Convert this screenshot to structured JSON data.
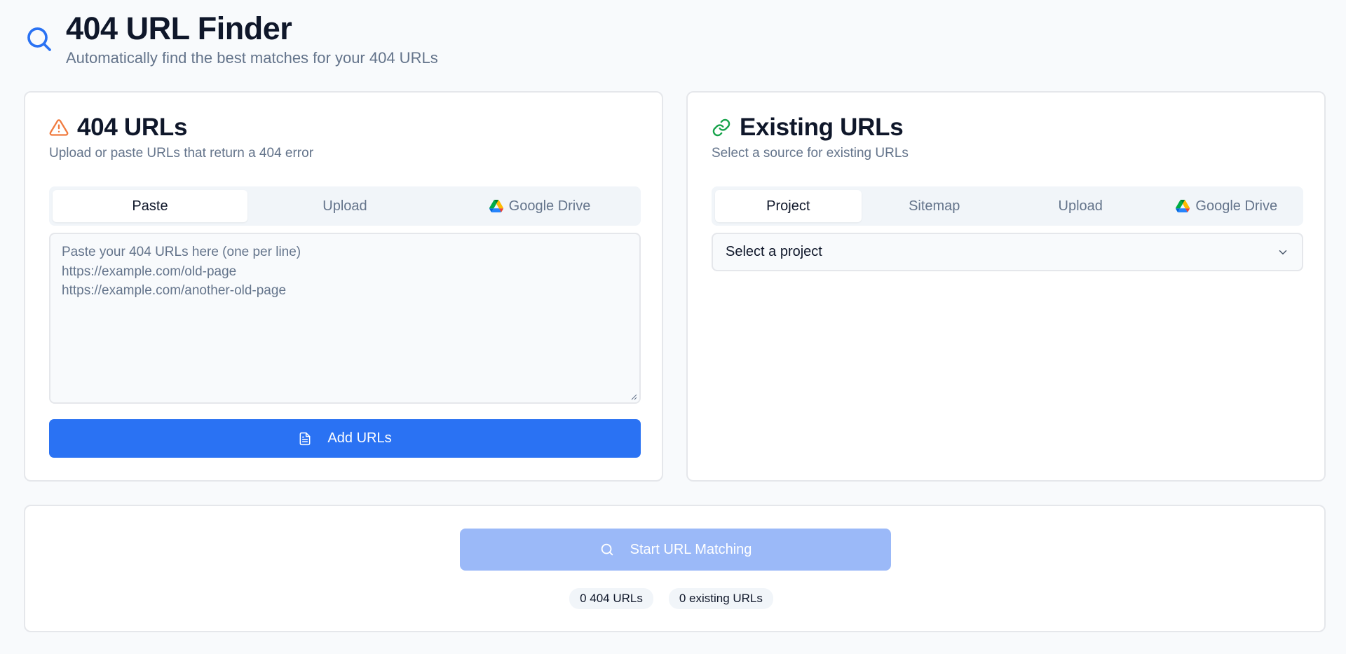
{
  "header": {
    "title": "404 URL Finder",
    "subtitle": "Automatically find the best matches for your 404 URLs",
    "icon": "search-icon"
  },
  "left_panel": {
    "title": "404 URLs",
    "icon": "warning-triangle-icon",
    "subtitle": "Upload or paste URLs that return a 404 error",
    "tabs": [
      {
        "label": "Paste",
        "active": true
      },
      {
        "label": "Upload",
        "active": false
      },
      {
        "label": "Google Drive",
        "active": false,
        "icon": "google-drive-icon"
      }
    ],
    "textarea_placeholder": "Paste your 404 URLs here (one per line)\nhttps://example.com/old-page\nhttps://example.com/another-old-page",
    "textarea_value": "",
    "add_button_label": "Add URLs",
    "add_button_icon": "file-text-icon"
  },
  "right_panel": {
    "title": "Existing URLs",
    "icon": "link-icon",
    "subtitle": "Select a source for existing URLs",
    "tabs": [
      {
        "label": "Project",
        "active": true
      },
      {
        "label": "Sitemap",
        "active": false
      },
      {
        "label": "Upload",
        "active": false
      },
      {
        "label": "Google Drive",
        "active": false,
        "icon": "google-drive-icon"
      }
    ],
    "select_placeholder": "Select a project"
  },
  "bottom_panel": {
    "start_button_label": "Start URL Matching",
    "start_button_disabled": true,
    "badge_404": "0 404 URLs",
    "badge_existing": "0 existing URLs"
  },
  "colors": {
    "primary": "#2a72f3",
    "primary_disabled": "#9bb9f8",
    "warning": "#f07b3f",
    "link": "#16a34a",
    "muted_text": "#64748b"
  }
}
